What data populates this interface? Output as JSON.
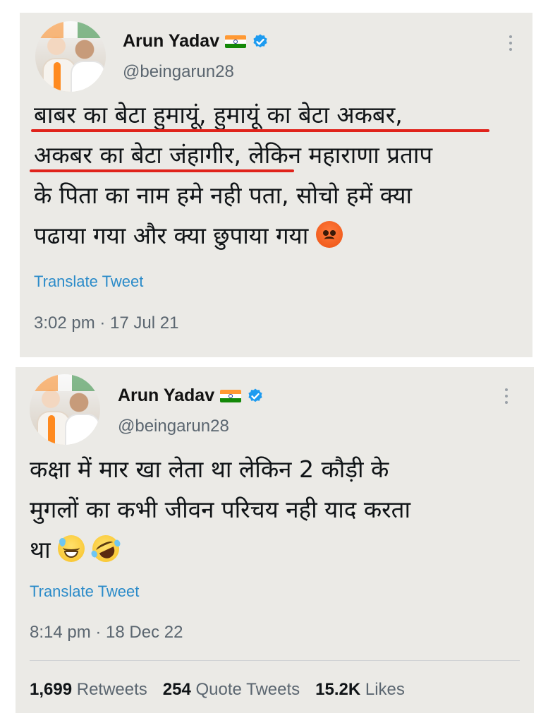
{
  "tweets": [
    {
      "author": {
        "name": "Arun Yadav",
        "handle": "@beingarun28",
        "flag_icon": "india-flag-icon",
        "verified_icon": "verified-badge-icon"
      },
      "lines": [
        "बाबर का बेटा हुमायूं, हुमायूं का बेटा अकबर,",
        "अकबर का बेटा जंहागीर, लेकिन महाराणा प्रताप",
        "के पिता का नाम हमे नही पता, सोचो हमें क्या",
        "पढाया गया और क्या छुपाया गया"
      ],
      "emoji": [
        "angry-face-emoji"
      ],
      "translate_label": "Translate Tweet",
      "timestamp": "3:02 pm · 17 Jul 21"
    },
    {
      "author": {
        "name": "Arun Yadav",
        "handle": "@beingarun28",
        "flag_icon": "india-flag-icon",
        "verified_icon": "verified-badge-icon"
      },
      "lines": [
        "कक्षा में मार खा लेता था लेकिन 2 कौड़ी के",
        "मुगलों का कभी जीवन परिचय नही याद करता",
        "था"
      ],
      "emoji": [
        "grinning-sweat-emoji",
        "rolling-on-floor-laughing-emoji"
      ],
      "translate_label": "Translate Tweet",
      "timestamp": "8:14 pm · 18 Dec 22",
      "stats": {
        "retweets_count": "1,699",
        "retweets_label": "Retweets",
        "quotes_count": "254",
        "quotes_label": "Quote Tweets",
        "likes_count": "15.2K",
        "likes_label": "Likes"
      }
    }
  ],
  "colors": {
    "card_bg": "#ebeae6",
    "link": "#2b8bc9",
    "underline": "#e0231b",
    "verified": "#1d9bf0"
  }
}
